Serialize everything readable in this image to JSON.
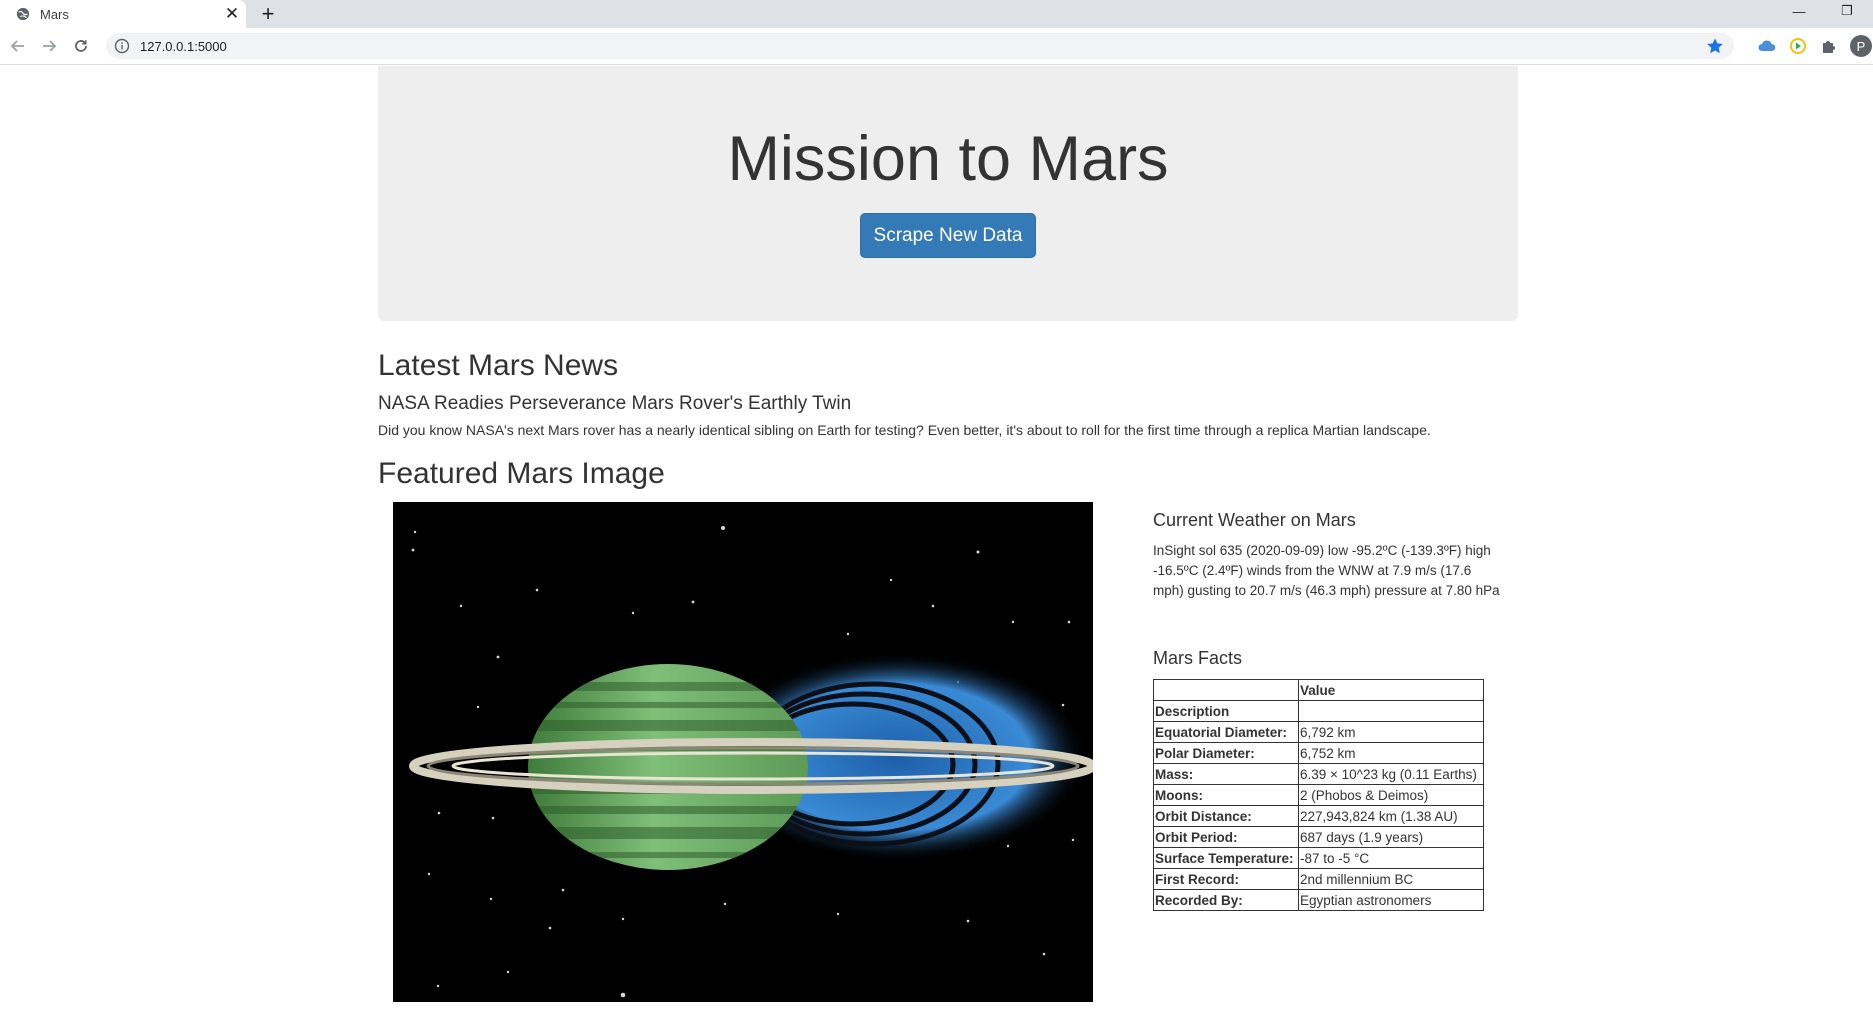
{
  "browser": {
    "tab_title": "Mars",
    "new_tab": "+",
    "url": "127.0.0.1:5000",
    "profile_initial": "P"
  },
  "jumbotron": {
    "title": "Mission to Mars",
    "button_label": "Scrape New Data"
  },
  "news": {
    "heading": "Latest Mars News",
    "title": "NASA Readies Perseverance Mars Rover's Earthly Twin",
    "paragraph": "Did you know NASA's next Mars rover has a nearly identical sibling on Earth for testing? Even better, it's about to roll for the first time through a replica Martian landscape."
  },
  "featured_image": {
    "heading": "Featured Mars Image"
  },
  "weather": {
    "heading": "Current Weather on Mars",
    "text": "InSight sol 635 (2020-09-09) low -95.2ºC (-139.3ºF) high -16.5ºC (2.4ºF) winds from the WNW at 7.9 m/s (17.6 mph) gusting to 20.7 m/s (46.3 mph) pressure at 7.80 hPa"
  },
  "facts": {
    "heading": "Mars Facts",
    "header": [
      "",
      "Value"
    ],
    "rows": [
      [
        "Description",
        ""
      ],
      [
        "Equatorial Diameter:",
        "6,792 km"
      ],
      [
        "Polar Diameter:",
        "6,752 km"
      ],
      [
        "Mass:",
        "6.39 × 10^23 kg (0.11 Earths)"
      ],
      [
        "Moons:",
        "2 (Phobos & Deimos)"
      ],
      [
        "Orbit Distance:",
        "227,943,824 km (1.38 AU)"
      ],
      [
        "Orbit Period:",
        "687 days (1.9 years)"
      ],
      [
        "Surface Temperature:",
        "-87 to -5 °C"
      ],
      [
        "First Record:",
        "2nd millennium BC"
      ],
      [
        "Recorded By:",
        "Egyptian astronomers"
      ]
    ]
  },
  "colors": {
    "button_blue": "#337ab7",
    "jumbotron_bg": "#eeeeee",
    "star_blue": "#1a73e8"
  }
}
